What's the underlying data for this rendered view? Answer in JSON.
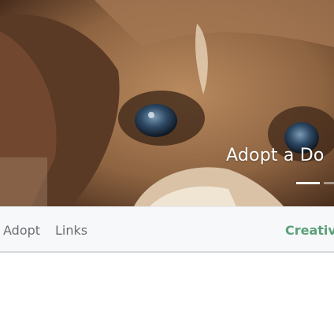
{
  "hero": {
    "image_alt": "puppy",
    "caption": "Adopt a Do",
    "indicators": [
      {
        "active": true
      },
      {
        "active": false
      }
    ]
  },
  "navbar": {
    "links": [
      {
        "label": "Adopt"
      },
      {
        "label": "Links"
      }
    ],
    "brand": "Creative",
    "brand_color": "#5aa07a"
  }
}
